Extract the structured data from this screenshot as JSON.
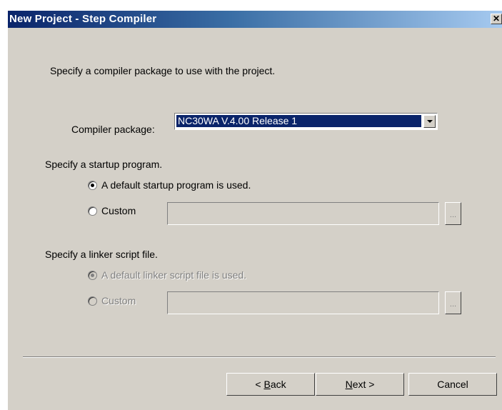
{
  "window": {
    "title": "New Project - Step Compiler",
    "close_label": "✕"
  },
  "intro_text": "Specify a compiler package to use with the project.",
  "compiler": {
    "label": "Compiler package:",
    "selected": "NC30WA V.4.00 Release 1"
  },
  "startup": {
    "heading": "Specify a startup program.",
    "default_label": "A default startup program is used.",
    "custom_label": "Custom",
    "custom_value": "",
    "browse_label": "..."
  },
  "linker": {
    "heading": "Specify a linker script file.",
    "default_label": "A default linker script file is used.",
    "custom_label": "Custom",
    "custom_value": "",
    "browse_label": "..."
  },
  "buttons": {
    "back_mnemonic": "B",
    "back_prefix": "< ",
    "back_rest": "ack",
    "next_mnemonic": "N",
    "next_rest": "ext >",
    "cancel": "Cancel"
  },
  "colors": {
    "title_start": "#0a246a",
    "title_end": "#a6caf0",
    "face": "#d4d0c8",
    "selection": "#0a246a"
  }
}
